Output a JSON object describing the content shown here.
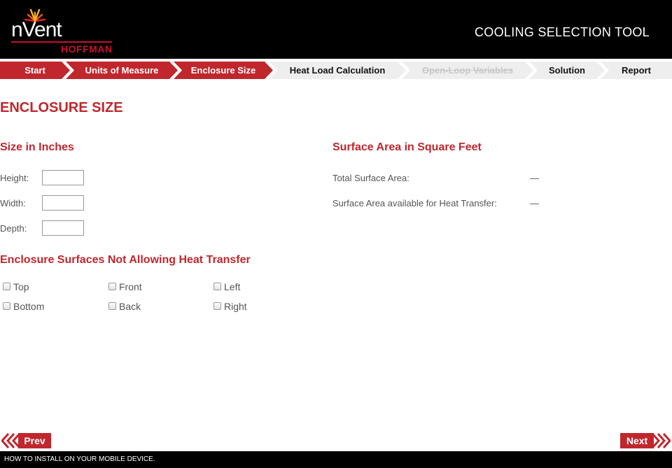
{
  "header": {
    "brand": "nVent",
    "brand_sub": "HOFFMAN",
    "app_title": "COOLING SELECTION TOOL"
  },
  "steps": [
    {
      "label": "Start",
      "state": "done"
    },
    {
      "label": "Units of Measure",
      "state": "done"
    },
    {
      "label": "Enclosure Size",
      "state": "active"
    },
    {
      "label": "Heat Load Calculation",
      "state": "todo"
    },
    {
      "label": "Open-Loop Variables",
      "state": "disabled"
    },
    {
      "label": "Solution",
      "state": "todo"
    },
    {
      "label": "Report",
      "state": "todo"
    }
  ],
  "page": {
    "title": "ENCLOSURE SIZE",
    "size_section": {
      "title": "Size in Inches",
      "height_label": "Height:",
      "height_value": "",
      "width_label": "Width:",
      "width_value": "",
      "depth_label": "Depth:",
      "depth_value": ""
    },
    "surface_section": {
      "title": "Surface Area in Square Feet",
      "total_label": "Total Surface Area:",
      "total_value": "—",
      "available_label": "Surface Area available for Heat Transfer:",
      "available_value": "—"
    },
    "surfaces_section": {
      "title": "Enclosure Surfaces Not Allowing Heat Transfer",
      "options": [
        {
          "label": "Top",
          "checked": false
        },
        {
          "label": "Front",
          "checked": false
        },
        {
          "label": "Left",
          "checked": false
        },
        {
          "label": "Bottom",
          "checked": false
        },
        {
          "label": "Back",
          "checked": false
        },
        {
          "label": "Right",
          "checked": false
        }
      ]
    }
  },
  "nav": {
    "prev_label": "Prev",
    "next_label": "Next"
  },
  "footer": {
    "link_text": "HOW TO INSTALL ON YOUR MOBILE DEVICE."
  },
  "colors": {
    "accent": "#c0272d",
    "header_bg": "#000000",
    "step_inactive": "#eeeeee"
  }
}
